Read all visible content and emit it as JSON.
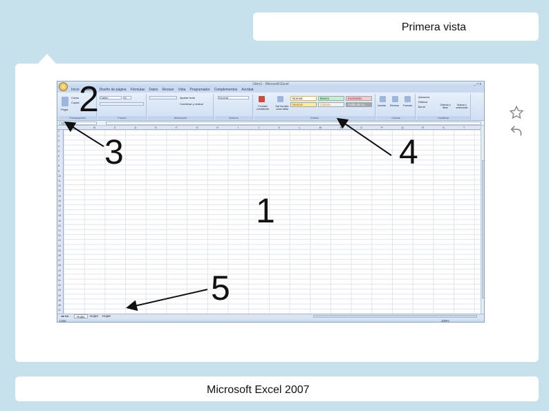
{
  "slide": {
    "title": "Primera vista",
    "footer": "Microsoft Excel 2007"
  },
  "side_icons": [
    "star-icon",
    "undo-icon"
  ],
  "excel": {
    "window_title": "Libro1 - Microsoft Excel",
    "window_controls": "_ □ x",
    "tabs": [
      "Inicio",
      "Insertar",
      "Diseño de página",
      "Fórmulas",
      "Datos",
      "Revisar",
      "Vista",
      "Programador",
      "Complementos",
      "Acrobat"
    ],
    "ribbon_groups": [
      "Portapapeles",
      "Fuente",
      "Alineación",
      "Número",
      "Estilos",
      "Celdas",
      "Modificar"
    ],
    "ribbon": {
      "paste": "Pegar",
      "cut": "Cortar",
      "copy": "Copiar",
      "font_name": "Calibri",
      "font_size": "11",
      "wrap": "Ajustar texto",
      "merge": "Combinar y centrar",
      "number_format": "General",
      "cond_format": "Formato condicional",
      "table_format": "Dar formato como tabla",
      "style_normal": "Normal",
      "style_bueno": "Bueno",
      "style_incorrecto": "Incorrecto",
      "style_neutral": "Neutral",
      "style_calculo": "Cálculo",
      "style_celda": "Celda de co...",
      "insert": "Insertar",
      "delete": "Eliminar",
      "format": "Formato",
      "autosum": "Autosuma",
      "fill": "Rellenar",
      "clear": "Borrar",
      "sort": "Ordenar y filtrar",
      "find": "Buscar y seleccionar"
    },
    "name_box": "A1",
    "columns": [
      "A",
      "B",
      "C",
      "D",
      "E",
      "F",
      "G",
      "H",
      "I",
      "J",
      "K",
      "L",
      "M",
      "N",
      "O",
      "P",
      "Q",
      "R",
      "S",
      "T"
    ],
    "rows": [
      "1",
      "2",
      "3",
      "4",
      "5",
      "6",
      "7",
      "8",
      "9",
      "10",
      "11",
      "12",
      "13",
      "14",
      "15",
      "16",
      "17",
      "18",
      "19",
      "20",
      "21",
      "22",
      "23",
      "24",
      "25",
      "26",
      "27",
      "28",
      "29",
      "30",
      "31",
      "32",
      "33",
      "34",
      "35",
      "36",
      "37",
      "38"
    ],
    "sheets": [
      "Hoja1",
      "Hoja2",
      "Hoja3"
    ],
    "status": "Listo",
    "zoom": "100%"
  },
  "annotations": [
    "1",
    "2",
    "3",
    "4",
    "5"
  ]
}
